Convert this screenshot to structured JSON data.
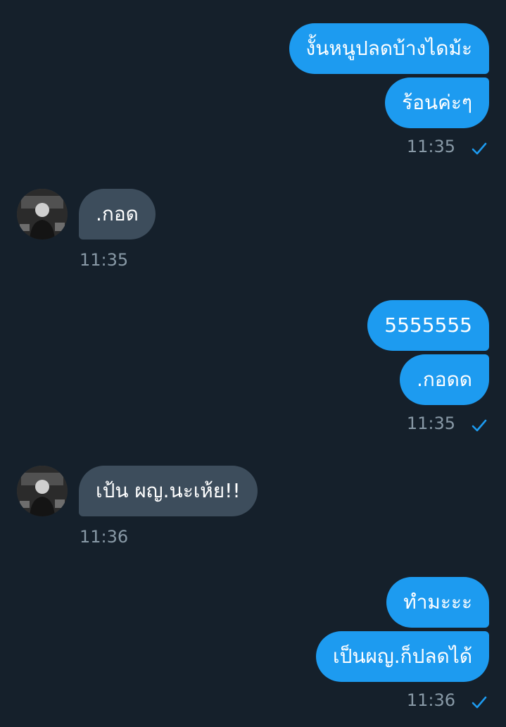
{
  "messages": [
    {
      "direction": "outgoing",
      "text": "งั้นหนูปลดบ้างไดม้ะ"
    },
    {
      "direction": "outgoing",
      "text": "ร้อนค่ะๆ"
    },
    {
      "direction": "outgoing_time",
      "time": "11:35"
    },
    {
      "direction": "incoming",
      "text": ".กอด"
    },
    {
      "direction": "incoming_time",
      "time": "11:35"
    },
    {
      "direction": "outgoing",
      "text": "5555555"
    },
    {
      "direction": "outgoing",
      "text": ".กอดด"
    },
    {
      "direction": "outgoing_time",
      "time": "11:35"
    },
    {
      "direction": "incoming",
      "text": "เป้น ผญ.นะเห้ย!!"
    },
    {
      "direction": "incoming_time",
      "time": "11:36"
    },
    {
      "direction": "outgoing",
      "text": "ทำมะะะ"
    },
    {
      "direction": "outgoing",
      "text": "เป็นผญ.ก็ปลดได้"
    },
    {
      "direction": "outgoing_time",
      "time": "11:36"
    }
  ],
  "colors": {
    "background": "#15202b",
    "outgoing_bubble": "#1d9bf0",
    "incoming_bubble": "#3d4d5c",
    "timestamp": "#8899a6",
    "read_check": "#1d9bf0"
  },
  "icons": {
    "read_receipt": "checkmark-icon",
    "avatar": "user-avatar"
  }
}
